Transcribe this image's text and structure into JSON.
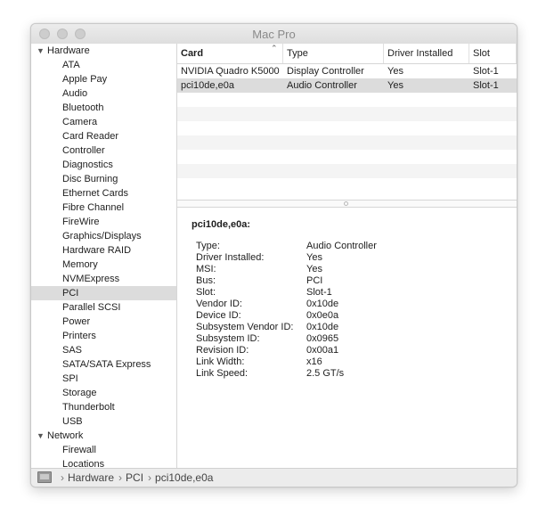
{
  "window": {
    "title": "Mac Pro"
  },
  "sidebar": {
    "groups": [
      {
        "label": "Hardware",
        "items": [
          "ATA",
          "Apple Pay",
          "Audio",
          "Bluetooth",
          "Camera",
          "Card Reader",
          "Controller",
          "Diagnostics",
          "Disc Burning",
          "Ethernet Cards",
          "Fibre Channel",
          "FireWire",
          "Graphics/Displays",
          "Hardware RAID",
          "Memory",
          "NVMExpress",
          "PCI",
          "Parallel SCSI",
          "Power",
          "Printers",
          "SAS",
          "SATA/SATA Express",
          "SPI",
          "Storage",
          "Thunderbolt",
          "USB"
        ]
      },
      {
        "label": "Network",
        "items": [
          "Firewall",
          "Locations"
        ]
      }
    ],
    "selected": "PCI"
  },
  "table": {
    "columns": [
      "Card",
      "Type",
      "Driver Installed",
      "Slot"
    ],
    "sorted_column": "Card",
    "rows": [
      [
        "NVIDIA Quadro K5000",
        "Display Controller",
        "Yes",
        "Slot-1"
      ],
      [
        "pci10de,e0a",
        "Audio Controller",
        "Yes",
        "Slot-1"
      ]
    ],
    "selected_row": 1
  },
  "detail": {
    "title": "pci10de,e0a:",
    "properties": [
      [
        "Type:",
        "Audio Controller"
      ],
      [
        "Driver Installed:",
        "Yes"
      ],
      [
        "MSI:",
        "Yes"
      ],
      [
        "Bus:",
        "PCI"
      ],
      [
        "Slot:",
        "Slot-1"
      ],
      [
        "Vendor ID:",
        "0x10de"
      ],
      [
        "Device ID:",
        "0x0e0a"
      ],
      [
        "Subsystem Vendor ID:",
        "0x10de"
      ],
      [
        "Subsystem ID:",
        "0x0965"
      ],
      [
        "Revision ID:",
        "0x00a1"
      ],
      [
        "Link Width:",
        "x16"
      ],
      [
        "Link Speed:",
        "2.5 GT/s"
      ]
    ]
  },
  "statusbar": {
    "breadcrumbs": [
      "Hardware",
      "PCI",
      "pci10de,e0a"
    ],
    "separator": "›"
  }
}
